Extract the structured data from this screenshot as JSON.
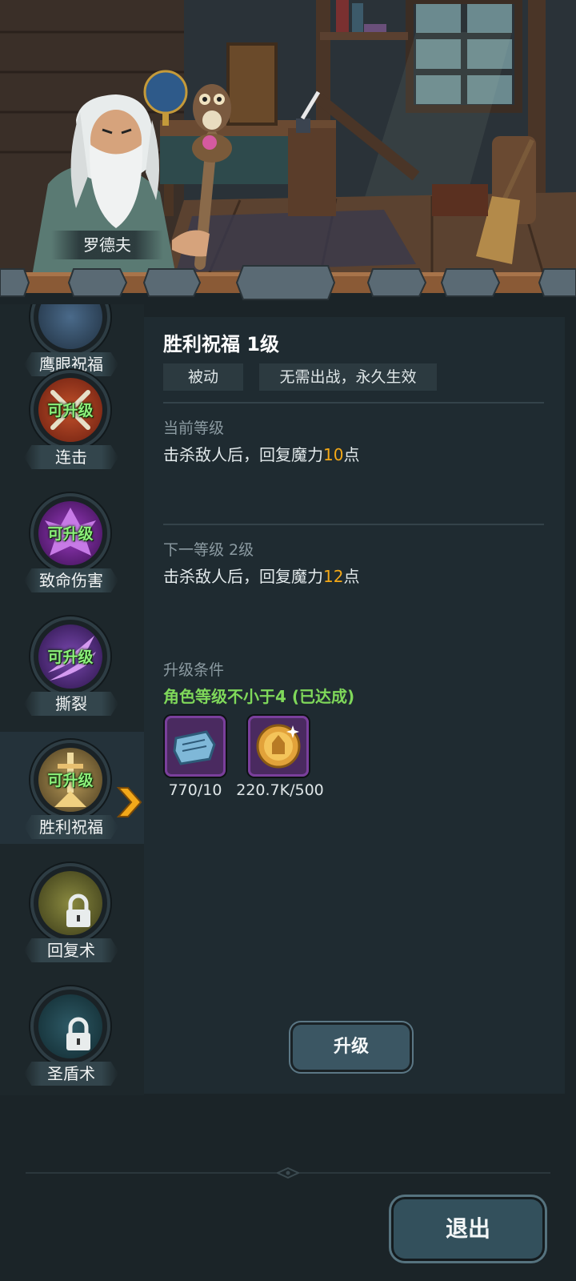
{
  "npc": {
    "name": "罗德夫"
  },
  "skills": [
    {
      "label": "鹰眼祝福",
      "badge": "",
      "icon": "eye-blessing-icon",
      "locked": false
    },
    {
      "label": "连击",
      "badge": "可升级",
      "icon": "crossed-swords-icon",
      "locked": false
    },
    {
      "label": "致命伤害",
      "badge": "可升级",
      "icon": "demon-strike-icon",
      "locked": false
    },
    {
      "label": "撕裂",
      "badge": "可升级",
      "icon": "tear-claw-icon",
      "locked": false
    },
    {
      "label": "胜利祝福",
      "badge": "可升级",
      "icon": "victory-sword-icon",
      "locked": false,
      "selected": true
    },
    {
      "label": "回复术",
      "badge": "",
      "icon": "lock-icon",
      "locked": true
    },
    {
      "label": "圣盾术",
      "badge": "",
      "icon": "lock-icon",
      "locked": true
    }
  ],
  "detail": {
    "title": "胜利祝福 1级",
    "tags": [
      "被动",
      "无需出战，永久生效"
    ],
    "current": {
      "title": "当前等级",
      "text_prefix": "击杀敌人后，回复魔力",
      "value": "10",
      "text_suffix": "点"
    },
    "next": {
      "title": "下一等级 2级",
      "text_prefix": "击杀敌人后，回复魔力",
      "value": "12",
      "text_suffix": "点"
    },
    "condition": {
      "title": "升级条件",
      "text": "角色等级不小于4 (已达成)"
    },
    "items": [
      {
        "icon": "skill-scroll-icon",
        "count": "770/10"
      },
      {
        "icon": "gold-coin-icon",
        "count": "220.7K/500"
      }
    ],
    "upgrade_label": "升级"
  },
  "exit_label": "退出",
  "colors": {
    "highlight": "#f3a817",
    "ready": "#7fd85a",
    "badge": "#8cf07a"
  }
}
